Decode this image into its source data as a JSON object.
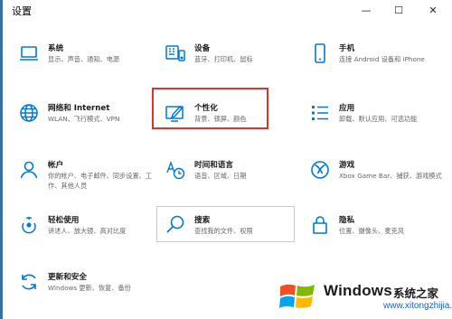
{
  "window": {
    "title": "设置"
  },
  "controls": {
    "minimize": "—",
    "maximize": "☐",
    "close": "✕"
  },
  "items": [
    {
      "title": "系统",
      "subtitle": "显示、声音、通知、电源",
      "icon": "laptop-icon"
    },
    {
      "title": "设备",
      "subtitle": "蓝牙、打印机、鼠标",
      "icon": "devices-icon"
    },
    {
      "title": "手机",
      "subtitle": "连接 Android 设备和 iPhone",
      "icon": "phone-icon"
    },
    {
      "title": "网络和 Internet",
      "subtitle": "WLAN、飞行模式、VPN",
      "icon": "globe-icon"
    },
    {
      "title": "个性化",
      "subtitle": "背景、锁屏、颜色",
      "icon": "personalization-icon"
    },
    {
      "title": "应用",
      "subtitle": "卸载、默认应用、可选功能",
      "icon": "apps-list-icon"
    },
    {
      "title": "帐户",
      "subtitle": "你的帐户、电子邮件、同步设置、工作、其他人员",
      "icon": "account-icon"
    },
    {
      "title": "时间和语言",
      "subtitle": "语音、区域、日期",
      "icon": "time-language-icon"
    },
    {
      "title": "游戏",
      "subtitle": "Xbox Game Bar、捕获、游戏模式",
      "icon": "xbox-icon"
    },
    {
      "title": "轻松使用",
      "subtitle": "讲述人、放大镜、高对比度",
      "icon": "ease-of-access-icon"
    },
    {
      "title": "搜索",
      "subtitle": "查找我的文件、权限",
      "icon": "search-icon"
    },
    {
      "title": "隐私",
      "subtitle": "位置、摄像头、麦克风",
      "icon": "lock-icon"
    },
    {
      "title": "更新和安全",
      "subtitle": "Windows 更新、恢复、备份",
      "icon": "update-icon"
    }
  ],
  "watermark": {
    "brand": "Windows",
    "cn": "系统之家",
    "url": "www.xitongzhijia.net"
  },
  "colors": {
    "accent": "#0078d7",
    "highlight": "#e0312b"
  }
}
